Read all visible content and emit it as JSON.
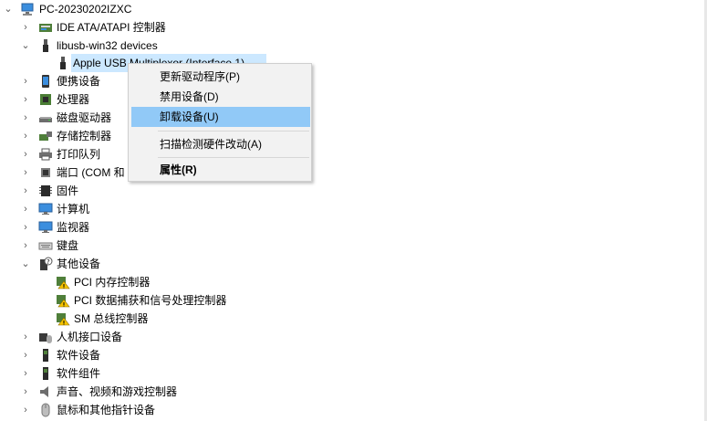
{
  "computer_name": "PC-20230202IZXC",
  "categories": [
    {
      "label": "IDE ATA/ATAPI 控制器",
      "icon": "ide-controller-icon",
      "expanded": false
    },
    {
      "label": "libusb-win32 devices",
      "icon": "usb-plug-icon",
      "expanded": true,
      "children": [
        {
          "label": "Apple USB Multiplexor (Interface 1)",
          "icon": "usb-plug-icon",
          "selected": true
        }
      ]
    },
    {
      "label": "便携设备",
      "icon": "portable-device-icon",
      "expanded": false
    },
    {
      "label": "处理器",
      "icon": "processor-icon",
      "expanded": false
    },
    {
      "label": "磁盘驱动器",
      "icon": "disk-drive-icon",
      "expanded": false
    },
    {
      "label": "存储控制器",
      "icon": "storage-controller-icon",
      "expanded": false
    },
    {
      "label": "打印队列",
      "icon": "printer-icon",
      "expanded": false
    },
    {
      "label": "端口 (COM 和",
      "icon": "port-icon",
      "expanded": false
    },
    {
      "label": "固件",
      "icon": "firmware-icon",
      "expanded": false
    },
    {
      "label": "计算机",
      "icon": "computer-icon",
      "expanded": false
    },
    {
      "label": "监视器",
      "icon": "monitor-icon",
      "expanded": false
    },
    {
      "label": "键盘",
      "icon": "keyboard-icon",
      "expanded": false
    },
    {
      "label": "其他设备",
      "icon": "unknown-device-icon",
      "expanded": true,
      "children": [
        {
          "label": "PCI 内存控制器",
          "icon": "warning-device-icon"
        },
        {
          "label": "PCI 数据捕获和信号处理控制器",
          "icon": "warning-device-icon"
        },
        {
          "label": "SM 总线控制器",
          "icon": "warning-device-icon"
        }
      ]
    },
    {
      "label": "人机接口设备",
      "icon": "hid-icon",
      "expanded": false
    },
    {
      "label": "软件设备",
      "icon": "software-device-icon",
      "expanded": false
    },
    {
      "label": "软件组件",
      "icon": "software-component-icon",
      "expanded": false
    },
    {
      "label": "声音、视频和游戏控制器",
      "icon": "speaker-icon",
      "expanded": false
    },
    {
      "label": "鼠标和其他指针设备",
      "icon": "mouse-icon",
      "expanded": false
    }
  ],
  "context_menu": {
    "update_driver": "更新驱动程序(P)",
    "disable_device": "禁用设备(D)",
    "uninstall_device": "卸载设备(U)",
    "scan_hardware": "扫描检测硬件改动(A)",
    "properties": "属性(R)",
    "highlighted": "uninstall_device"
  },
  "colors": {
    "selection": "#cce8ff",
    "menu_highlight": "#91c9f7",
    "menu_bg": "#f2f2f2"
  }
}
